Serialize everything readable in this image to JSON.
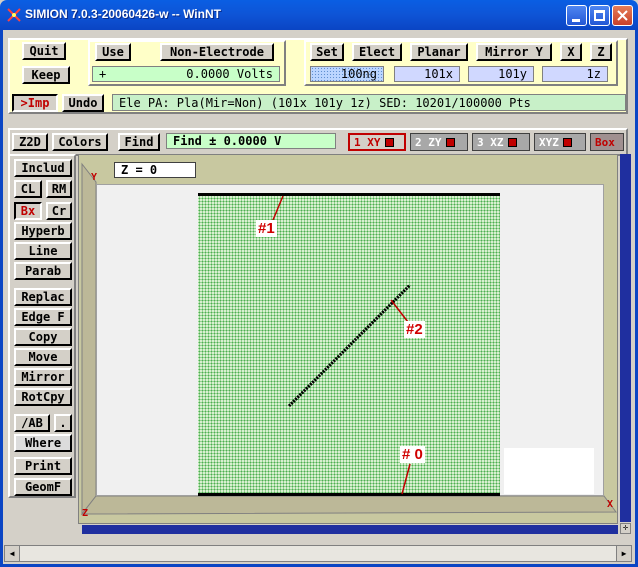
{
  "window": {
    "title": "SIMION 7.0.3-20060426-w -- WinNT",
    "controls": [
      "minimize",
      "maximize",
      "close"
    ]
  },
  "top_left": {
    "quit": "Quit",
    "keep": "Keep",
    "imp": ">Imp",
    "undo": "Undo"
  },
  "electrode_panel": {
    "use": "Use",
    "type": "Non-Electrode",
    "volts_sign": "+",
    "volts_value": "0.0000 Volts"
  },
  "settings_panel": {
    "set": "Set",
    "elect": "Elect",
    "planar": "Planar",
    "mirror": "Mirror Y",
    "x": "X",
    "z": "Z",
    "ng": "100ng",
    "dim_x": "101x",
    "dim_y": "101y",
    "dim_z": "1z"
  },
  "status": {
    "text": "Ele PA: Pla(Mir=Non) (101x 101y 1z) SED: 10201/100000 Pts"
  },
  "view_bar": {
    "z2d": "Z2D",
    "colors": "Colors",
    "find": "Find",
    "find_field": "Find ±      0.0000 V",
    "tabs": [
      {
        "label": "1 XY",
        "active": true
      },
      {
        "label": "2 ZY",
        "active": false
      },
      {
        "label": "3 XZ",
        "active": false
      },
      {
        "label": "XYZ",
        "active": false
      },
      {
        "label": "Box",
        "active": false
      }
    ]
  },
  "left_tools": {
    "includ": "Includ",
    "cl": "CL",
    "rm": "RM",
    "bx": "Bx",
    "cr": "Cr",
    "hyperb": "Hyperb",
    "line": "Line",
    "parab": "Parab",
    "replac": "Replac",
    "edge_f": "Edge F",
    "copy": "Copy",
    "move": "Move",
    "mirror": "Mirror",
    "rotcpy": "RotCpy",
    "ab": "/AB",
    "dot": ".",
    "where": "Where",
    "print": "Print",
    "geomf": "GeomF"
  },
  "canvas": {
    "z_field": "Z =        0",
    "axis_y": "Y",
    "axis_x": "X",
    "axis_z": "Z",
    "labels": {
      "l1": "#1",
      "l2": "#2",
      "l0": "# 0"
    }
  }
}
